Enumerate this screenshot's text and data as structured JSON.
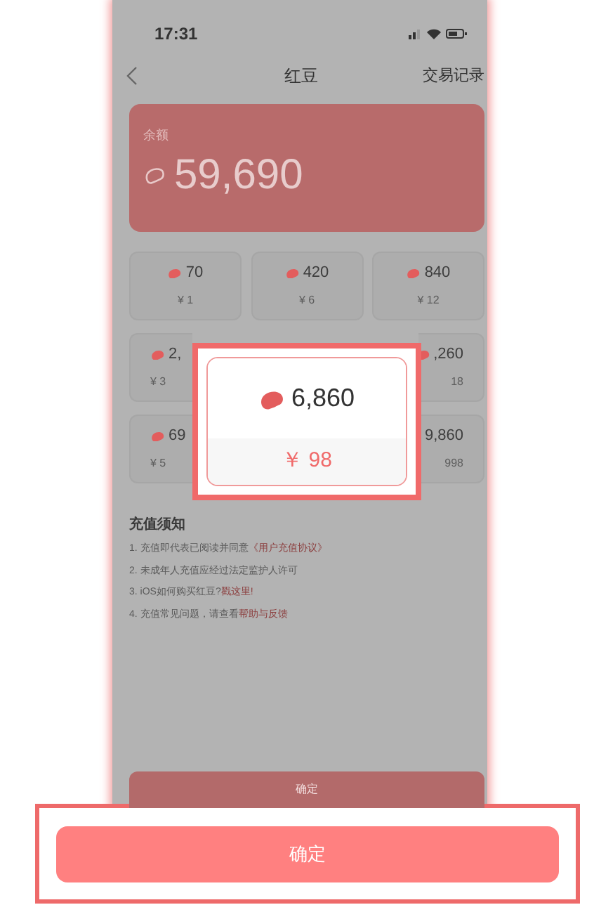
{
  "status_bar": {
    "time": "17:31"
  },
  "nav": {
    "title": "红豆",
    "action": "交易记录"
  },
  "balance": {
    "label": "余额",
    "amount": "59,690"
  },
  "package_rows": [
    {
      "cells": [
        {
          "kind": "full",
          "beans": "70",
          "price": "¥ 1"
        },
        {
          "kind": "full",
          "beans": "420",
          "price": "¥ 6"
        },
        {
          "kind": "full",
          "beans": "840",
          "price": "¥ 12"
        }
      ]
    },
    {
      "cells": [
        {
          "kind": "cut_right",
          "beans": "2,",
          "price": "¥ 3"
        },
        {
          "kind": "cut_left",
          "beans": ",260",
          "price": "18"
        }
      ]
    },
    {
      "cells": [
        {
          "kind": "cut_right",
          "beans": "69",
          "price": "¥ 5"
        },
        {
          "kind": "cut_left_bare",
          "beans": "9,860",
          "price": "998"
        }
      ]
    }
  ],
  "highlight": {
    "beans": "6,860",
    "price": "￥ 98"
  },
  "notice": {
    "title": "充值须知",
    "items": [
      {
        "text": "1. 充值即代表已阅读并同意 ",
        "link": "《用户充值协议》"
      },
      {
        "text": "2. 未成年人充值应经过法定监护人许可"
      },
      {
        "text": "3. iOS如何购买红豆? ",
        "link": "戳这里!"
      },
      {
        "text": "4. 充值常见问题，请查看 ",
        "link": "帮助与反馈"
      }
    ]
  },
  "dimmed_button": "确定",
  "confirm_button": "确定"
}
